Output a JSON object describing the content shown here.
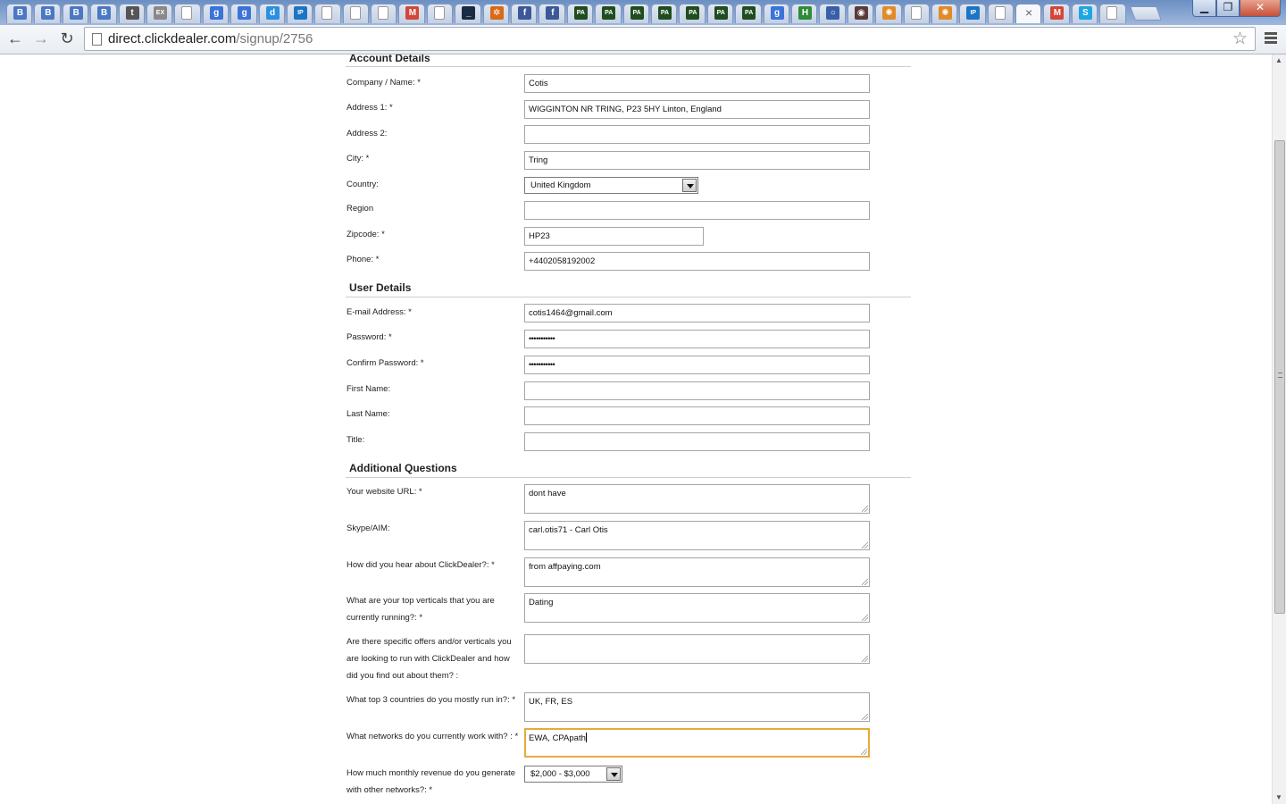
{
  "browser": {
    "tabs": [
      {
        "icon": "blogger-b-icon",
        "glyph": "B",
        "color": "#4a78c2"
      },
      {
        "icon": "blogger-b-icon",
        "glyph": "B",
        "color": "#4a78c2"
      },
      {
        "icon": "blogger-b-icon",
        "glyph": "B",
        "color": "#4a78c2"
      },
      {
        "icon": "blogger-b-icon",
        "glyph": "B",
        "color": "#4a78c2"
      },
      {
        "icon": "script-t-icon",
        "glyph": "t",
        "color": "#555555"
      },
      {
        "icon": "ex-icon",
        "glyph": "EX",
        "color": "#888888"
      },
      {
        "icon": "page-icon",
        "glyph": "",
        "color": "#ffffff"
      },
      {
        "icon": "google-icon",
        "glyph": "g",
        "color": "#3b73d9"
      },
      {
        "icon": "google-icon",
        "glyph": "g",
        "color": "#3b73d9"
      },
      {
        "icon": "d-logo-icon",
        "glyph": "d",
        "color": "#2d8fe0"
      },
      {
        "icon": "ip-icon",
        "glyph": "IP",
        "color": "#1d74c4"
      },
      {
        "icon": "page-icon",
        "glyph": "",
        "color": "#ffffff"
      },
      {
        "icon": "page-icon",
        "glyph": "",
        "color": "#ffffff"
      },
      {
        "icon": "page-icon",
        "glyph": "",
        "color": "#ffffff"
      },
      {
        "icon": "gmail-icon",
        "glyph": "M",
        "color": "#d44638"
      },
      {
        "icon": "page-icon",
        "glyph": "",
        "color": "#ffffff"
      },
      {
        "icon": "terminal-icon",
        "glyph": "_",
        "color": "#1a2a44"
      },
      {
        "icon": "gear-orange-icon",
        "glyph": "✲",
        "color": "#d96a1a"
      },
      {
        "icon": "facebook-icon",
        "glyph": "f",
        "color": "#3b5998"
      },
      {
        "icon": "facebook-icon",
        "glyph": "f",
        "color": "#3b5998"
      },
      {
        "icon": "pa-icon",
        "glyph": "PA",
        "color": "#1f4d1f"
      },
      {
        "icon": "pa-icon",
        "glyph": "PA",
        "color": "#1f4d1f"
      },
      {
        "icon": "pa-icon",
        "glyph": "PA",
        "color": "#1f4d1f"
      },
      {
        "icon": "pa-icon",
        "glyph": "PA",
        "color": "#1f4d1f"
      },
      {
        "icon": "pa-icon",
        "glyph": "PA",
        "color": "#1f4d1f"
      },
      {
        "icon": "pa-icon",
        "glyph": "PA",
        "color": "#1f4d1f"
      },
      {
        "icon": "pa-icon",
        "glyph": "PA",
        "color": "#1f4d1f"
      },
      {
        "icon": "google-icon",
        "glyph": "g",
        "color": "#3b73d9"
      },
      {
        "icon": "h-icon",
        "glyph": "H",
        "color": "#2e8b3a"
      },
      {
        "icon": "circle-icon",
        "glyph": "○",
        "color": "#3a5fa8"
      },
      {
        "icon": "badge-icon",
        "glyph": "◉",
        "color": "#5a3a3a"
      },
      {
        "icon": "pinwheel-icon",
        "glyph": "✺",
        "color": "#e08a2a"
      },
      {
        "icon": "page-icon",
        "glyph": "",
        "color": "#ffffff"
      },
      {
        "icon": "pinwheel-icon",
        "glyph": "✺",
        "color": "#e08a2a"
      },
      {
        "icon": "ip-icon",
        "glyph": "IP",
        "color": "#1d74c4"
      },
      {
        "icon": "page-icon",
        "glyph": "",
        "color": "#ffffff"
      },
      {
        "icon": "close-icon",
        "glyph": "×",
        "color": "",
        "active": true
      },
      {
        "icon": "gmail-icon",
        "glyph": "M",
        "color": "#d44638"
      },
      {
        "icon": "skype-icon",
        "glyph": "S",
        "color": "#1ea6e0"
      },
      {
        "icon": "page-icon",
        "glyph": "",
        "color": "#ffffff"
      }
    ],
    "window_controls": {
      "minimize": "▁",
      "maximize": "❐",
      "close": "✕"
    },
    "nav": {
      "back": "←",
      "forward": "→",
      "reload": "↻"
    },
    "url_host": "direct.clickdealer.com",
    "url_path": "/signup/2756",
    "star": "☆"
  },
  "form": {
    "account_title": "Account Details",
    "user_title": "User Details",
    "additional_title": "Additional Questions",
    "fields": {
      "company": {
        "label": "Company / Name: *",
        "value": "Cotis"
      },
      "address1": {
        "label": "Address 1: *",
        "value": "WIGGINTON NR TRING, P23 5HY Linton, England"
      },
      "address2": {
        "label": "Address 2:",
        "value": ""
      },
      "city": {
        "label": "City: *",
        "value": "Tring"
      },
      "country": {
        "label": "Country:",
        "value": "United Kingdom"
      },
      "region": {
        "label": "Region",
        "value": ""
      },
      "zipcode": {
        "label": "Zipcode: *",
        "value": "HP23"
      },
      "phone": {
        "label": "Phone: *",
        "value": "+4402058192002"
      },
      "email": {
        "label": "E-mail Address: *",
        "value": "cotis1464@gmail.com"
      },
      "password": {
        "label": "Password: *",
        "value": "•••••••••••"
      },
      "confirm_password": {
        "label": "Confirm Password: *",
        "value": "•••••••••••"
      },
      "first_name": {
        "label": "First Name:",
        "value": ""
      },
      "last_name": {
        "label": "Last Name:",
        "value": ""
      },
      "title": {
        "label": "Title:",
        "value": ""
      },
      "website": {
        "label": "Your website URL:  *",
        "value": "dont have"
      },
      "skype": {
        "label": "Skype/AIM:",
        "value": "carl.otis71 - Carl Otis"
      },
      "hear": {
        "label": "How did you hear about ClickDealer?:  *",
        "value": "from affpaying.com"
      },
      "verticals": {
        "label": "What are your top verticals that you are currently running?:  *",
        "value": "Dating"
      },
      "offers": {
        "label": "Are there specific offers and/or verticals you are looking to run with ClickDealer and how did you find out about them? :",
        "value": ""
      },
      "countries": {
        "label": "What top 3 countries do you mostly run in?:  *",
        "value": "UK, FR, ES"
      },
      "networks": {
        "label": "What networks do you currently work with? :  *",
        "value": "EWA, CPApath"
      },
      "revenue": {
        "label": "How much monthly revenue do you generate with other networks?:  *",
        "value": "$2,000 - $3,000"
      }
    }
  }
}
